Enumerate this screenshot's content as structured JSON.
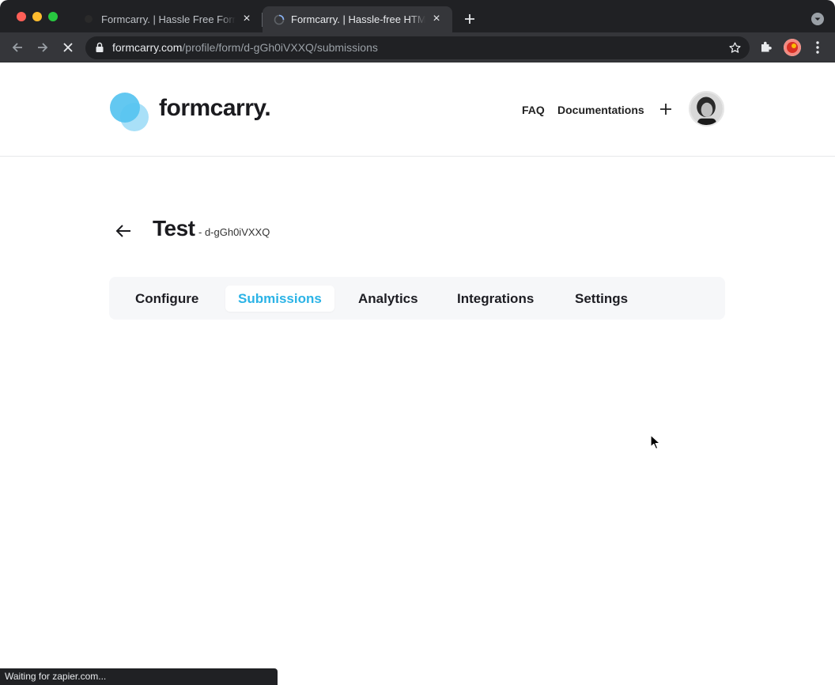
{
  "browser": {
    "tabs": [
      {
        "title": "Formcarry. | Hassle Free Forms",
        "favicon": "formcarry-favicon",
        "active": false
      },
      {
        "title": "Formcarry. | Hassle-free HTML",
        "favicon": "loading-spinner-icon",
        "active": true
      }
    ],
    "url": {
      "host": "formcarry.com",
      "path": "/profile/form/d-gGh0iVXXQ/submissions"
    },
    "status_text": "Waiting for zapier.com..."
  },
  "site": {
    "logo_text": "formcarry.",
    "nav": {
      "faq": "FAQ",
      "docs": "Documentations"
    }
  },
  "form": {
    "title": "Test",
    "id_label": "- d-gGh0iVXXQ"
  },
  "form_tabs": [
    {
      "label": "Configure",
      "active": false
    },
    {
      "label": "Submissions",
      "active": true
    },
    {
      "label": "Analytics",
      "active": false
    },
    {
      "label": "Integrations",
      "active": false
    },
    {
      "label": "Settings",
      "active": false
    }
  ],
  "colors": {
    "accent": "#2bb3e6",
    "logo_primary": "#56c3f0",
    "logo_secondary": "#a9e0f8",
    "chrome_dark": "#202124",
    "chrome_mid": "#35363a"
  }
}
